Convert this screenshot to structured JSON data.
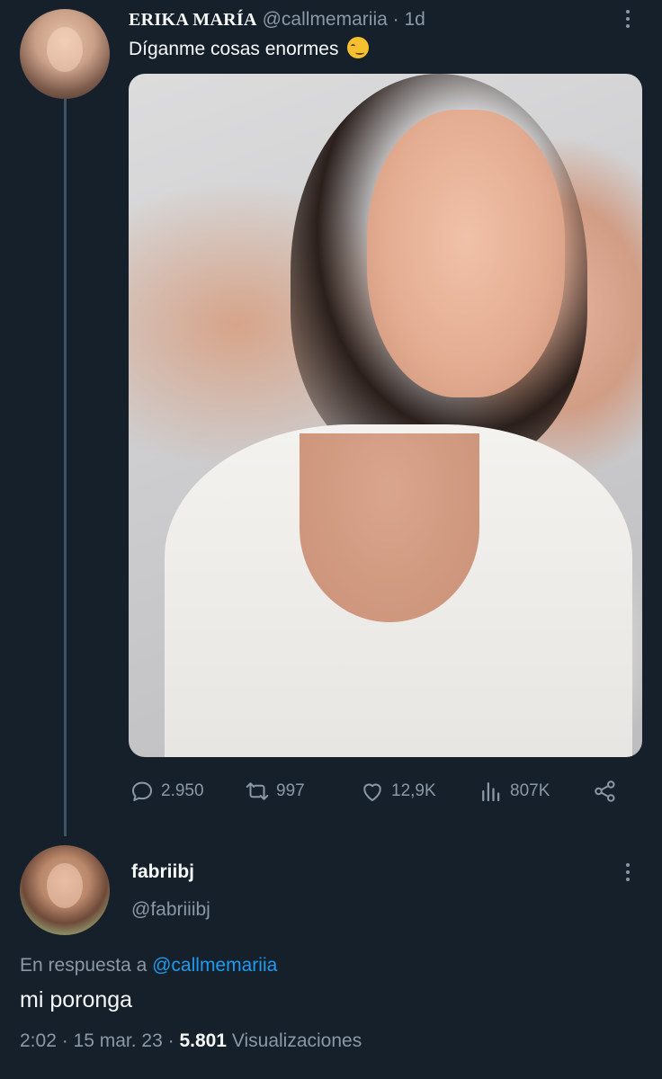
{
  "original_tweet": {
    "display_name": "ERIKA MARÍA",
    "handle": "@callmemariia",
    "separator": " · ",
    "time": "1d",
    "text": "Díganme cosas enormes",
    "stats": {
      "replies": "2.950",
      "retweets": "997",
      "likes": "12,9K",
      "views": "807K"
    }
  },
  "reply": {
    "display_name": "fabriibj",
    "handle": "@fabriiibj",
    "reply_prefix": "En respuesta a",
    "reply_target": "@callmemariia",
    "text": "mi poronga",
    "timestamp": "2:02 · 15 mar. 23 · ",
    "views_count": "5.801",
    "views_label": "Visualizaciones"
  },
  "icons": {
    "reply": "reply-bubble-icon",
    "retweet": "retweet-icon",
    "like": "heart-icon",
    "views": "bar-chart-icon",
    "share": "share-icon",
    "more": "more-vertical-icon"
  },
  "colors": {
    "background": "#15202b",
    "text": "#f7f9f9",
    "muted": "#8b98a5",
    "link": "#1d9bf0",
    "thread_line": "#3d5466"
  }
}
